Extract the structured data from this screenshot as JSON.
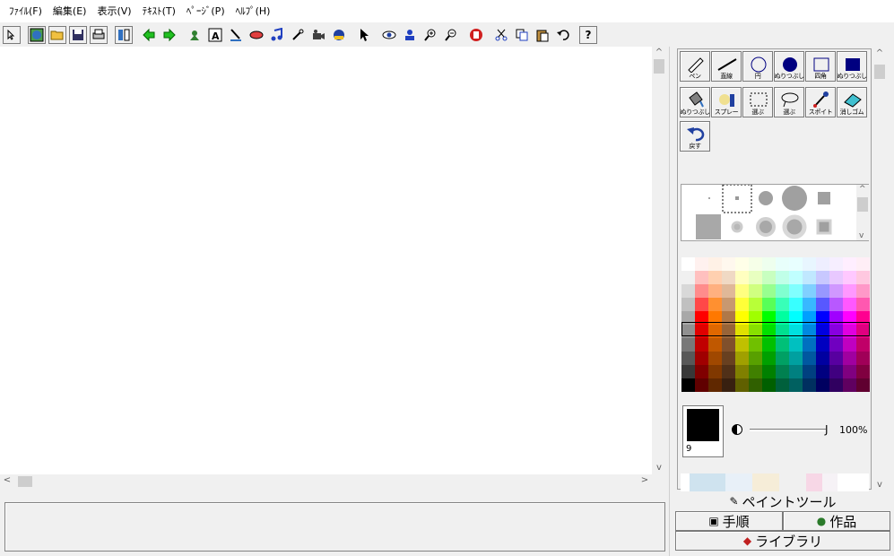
{
  "menu": {
    "items": [
      "ﾌｧｲﾙ(F)",
      "編集(E)",
      "表示(V)",
      "ﾃｷｽﾄ(T)",
      "ﾍﾟｰｼﾞ(P)",
      "ﾍﾙﾌﾟ(H)"
    ]
  },
  "toolbar": {
    "help_label": "?"
  },
  "paint_tools": [
    {
      "label": "ペン",
      "icon": "pen-icon"
    },
    {
      "label": "直線",
      "icon": "line-icon"
    },
    {
      "label": "円",
      "icon": "circle-icon"
    },
    {
      "label": "ぬりつぶし",
      "icon": "filled-circle-icon"
    },
    {
      "label": "四角",
      "icon": "rectangle-icon"
    },
    {
      "label": "ぬりつぶし",
      "icon": "filled-rectangle-icon"
    },
    {
      "label": "ぬりつぶし",
      "icon": "paint-bucket-icon"
    },
    {
      "label": "スプレー",
      "icon": "spray-icon"
    },
    {
      "label": "選ぶ",
      "icon": "rect-select-icon"
    },
    {
      "label": "選ぶ",
      "icon": "lasso-select-icon"
    },
    {
      "label": "スポイト",
      "icon": "eyedropper-icon"
    },
    {
      "label": "消しゴム",
      "icon": "eraser-icon"
    },
    {
      "label": "戻す",
      "icon": "undo-icon"
    }
  ],
  "current_color": {
    "hex": "#000000",
    "size": "9"
  },
  "opacity": {
    "value": "100%",
    "level": 1.0
  },
  "tabs": {
    "paint_tool": "ペイントツール",
    "steps": "手順",
    "works": "作品",
    "library": "ライブラリ"
  },
  "palette": [
    [
      "#ffffff",
      "#fff1ef",
      "#fff1e6",
      "#fff8ee",
      "#ffffe8",
      "#f6ffe8",
      "#eeffee",
      "#e8fffb",
      "#e8ffff",
      "#e8f6ff",
      "#eeeeff",
      "#f6eeff",
      "#ffeeff",
      "#ffeef6"
    ],
    [
      "#f0f0f0",
      "#ffc0bf",
      "#ffd0b0",
      "#f0d9c4",
      "#ffffc0",
      "#e8ffc0",
      "#c8ffc0",
      "#c0ffe8",
      "#c0ffff",
      "#c0e8ff",
      "#c8c8ff",
      "#e8c8ff",
      "#ffc8ff",
      "#ffc8e0"
    ],
    [
      "#d8d8d8",
      "#ff8c8c",
      "#ffb080",
      "#e0b898",
      "#ffff80",
      "#d0ff80",
      "#98ff90",
      "#80ffd0",
      "#80ffff",
      "#80d0ff",
      "#9898ff",
      "#d098ff",
      "#ff98ff",
      "#ff98c8"
    ],
    [
      "#c0c0c0",
      "#ff4848",
      "#ff9030",
      "#c89870",
      "#ffff38",
      "#b8ff38",
      "#58ff58",
      "#38ffb8",
      "#38ffff",
      "#38b8ff",
      "#5858ff",
      "#b858ff",
      "#ff58ff",
      "#ff58b0"
    ],
    [
      "#a8a8a8",
      "#ff0000",
      "#ff7800",
      "#b07848",
      "#ffff00",
      "#a0ff00",
      "#00ff00",
      "#00ffa0",
      "#00ffff",
      "#00a0ff",
      "#0000ff",
      "#a000ff",
      "#ff00ff",
      "#ff0090"
    ],
    [
      "#909090",
      "#e00000",
      "#e06800",
      "#986438",
      "#e0e000",
      "#88e000",
      "#00e000",
      "#00e090",
      "#00e0e0",
      "#0088e0",
      "#0000e0",
      "#8800e0",
      "#e000e0",
      "#e00080"
    ],
    [
      "#787878",
      "#c00000",
      "#c05800",
      "#80502c",
      "#c0c000",
      "#70c000",
      "#00c000",
      "#00c078",
      "#00c0c0",
      "#0070c0",
      "#0000c0",
      "#7000c0",
      "#c000c0",
      "#c00068"
    ],
    [
      "#585858",
      "#a00000",
      "#a04800",
      "#684020",
      "#a0a000",
      "#58a000",
      "#00a000",
      "#00a064",
      "#00a0a0",
      "#0058a0",
      "#0000a0",
      "#5800a0",
      "#a000a0",
      "#a00058"
    ],
    [
      "#383838",
      "#800000",
      "#803800",
      "#503018",
      "#808000",
      "#408000",
      "#008000",
      "#008050",
      "#008080",
      "#004080",
      "#000080",
      "#400080",
      "#800080",
      "#800040"
    ],
    [
      "#000000",
      "#600000",
      "#602800",
      "#382010",
      "#606000",
      "#306000",
      "#006000",
      "#00603c",
      "#006060",
      "#003060",
      "#000060",
      "#300060",
      "#600060",
      "#600030"
    ]
  ]
}
